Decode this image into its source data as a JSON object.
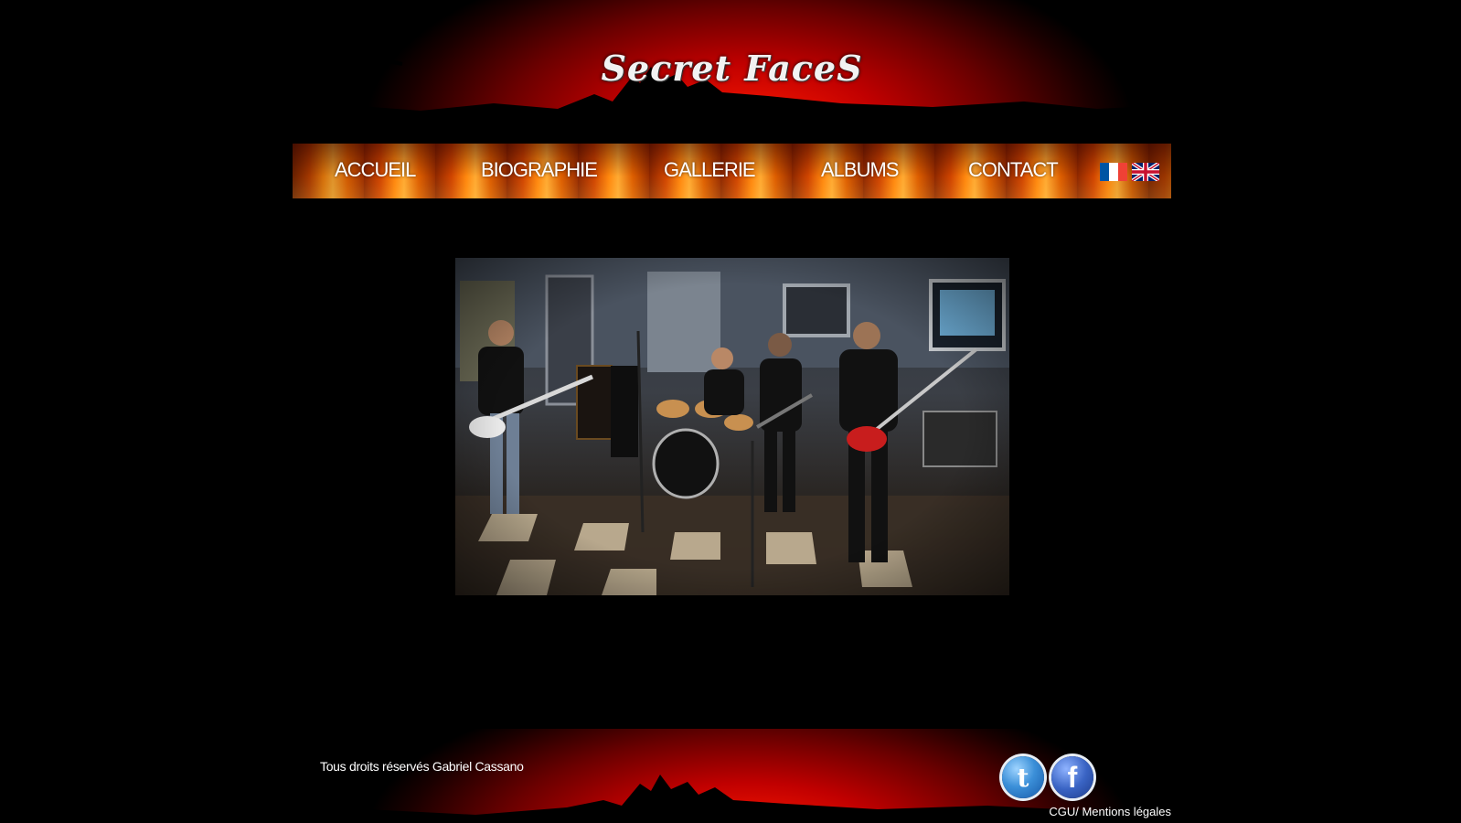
{
  "header": {
    "logo_text": "Secret FaceS"
  },
  "nav": {
    "items": [
      {
        "label": "ACCUEIL"
      },
      {
        "label": "BIOGRAPHIE"
      },
      {
        "label": "GALLERIE"
      },
      {
        "label": "ALBUMS"
      },
      {
        "label": "CONTACT"
      }
    ],
    "languages": [
      {
        "icon": "french-flag-icon",
        "colors": [
          "#0055a4",
          "#ffffff",
          "#ef4135"
        ]
      },
      {
        "icon": "uk-flag-icon",
        "colors": [
          "#012169",
          "#ffffff",
          "#c8102e"
        ]
      }
    ]
  },
  "main": {
    "photo": {
      "icon": "band-photo"
    }
  },
  "footer": {
    "copyright": "Tous droits réservés Gabriel Cassano",
    "social": [
      {
        "icon": "twitter-icon",
        "glyph": "t"
      },
      {
        "icon": "facebook-icon",
        "glyph": "f"
      }
    ],
    "legal_link": "CGU/ Mentions légales"
  },
  "colors": {
    "background": "#000000",
    "accent_red": "#c00000",
    "fire_orange": "#ff8a10",
    "text": "#ffffff"
  }
}
